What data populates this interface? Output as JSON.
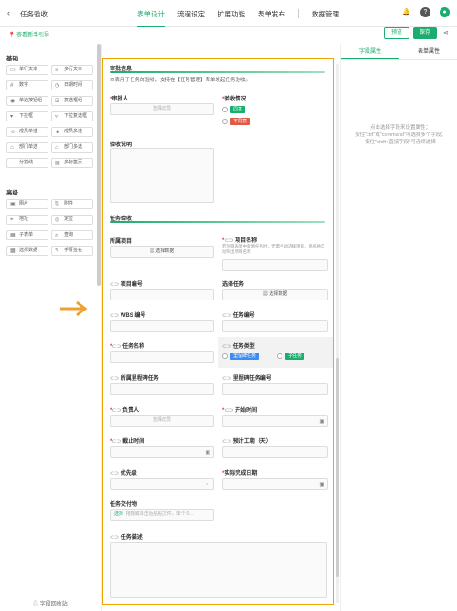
{
  "app": {
    "title": "任务验收",
    "back_icon": "chevron-left-icon"
  },
  "nav": {
    "tabs": [
      "表单设计",
      "流程设定",
      "扩展功能",
      "表单发布"
    ],
    "data_mgmt": "数据管理"
  },
  "subbar": {
    "guide": "查看新手引导",
    "preview": "预览",
    "save": "保存"
  },
  "palette": {
    "basic_title": "基础",
    "basic": [
      "单行文本",
      "多行文本",
      "数字",
      "日期时间",
      "单选按钮组",
      "复选框组",
      "下拉框",
      "下拉复选框",
      "成员单选",
      "成员多选",
      "部门单选",
      "部门多选",
      "分割线",
      "多标签页"
    ],
    "advanced_title": "高级",
    "advanced": [
      "图片",
      "附件",
      "地址",
      "定位",
      "子表单",
      "查询",
      "选择数据",
      "手写签名"
    ],
    "recycle": "字段回收站"
  },
  "form": {
    "sec1_title": "审批信息",
    "sec1_desc": "本表用于任务的验收，支持在【任务管理】表单发起任务验收。",
    "approver_label": "审批人",
    "approver_placeholder": "选择成员",
    "accept_label": "验收情况",
    "accept_options": [
      "同意",
      "不同意"
    ],
    "accept_note_label": "验收说明",
    "sec2_title": "任务验收",
    "project_label": "所属项目",
    "select_data": "选择数据",
    "project_name_label": "项目名称",
    "project_name_hint": "若项目表单中新增任务时，无需手动选择项目，系统将自动带出项目名称",
    "project_no_label": "项目编号",
    "choose_task_label": "选择任务",
    "wbs_label": "WBS 编号",
    "task_no_label": "任务编号",
    "task_name_label": "任务名称",
    "task_type_label": "任务类型",
    "task_type_options": [
      "里程碑任务",
      "子任务"
    ],
    "milestone_label": "所属里程碑任务",
    "milestone_no_label": "里程碑任务编号",
    "owner_label": "负责人",
    "owner_placeholder": "选择成员",
    "start_label": "开始时间",
    "deadline_label": "截止时间",
    "est_label": "预计工期（天）",
    "priority_label": "优先级",
    "actual_label": "实际完成日期",
    "deliverable_label": "任务交付物",
    "upload_btn": "选择",
    "upload_hint": "拖拽或单击后粘贴文件，单个(0...",
    "task_desc_label": "任务描述"
  },
  "right": {
    "tabs": [
      "字段属性",
      "表单属性"
    ],
    "hint_lines": [
      "点击选择字段来设置属性；",
      "按住\"ctrl\"或\"command\"可选择多个字段；",
      "按住\"shift+直接字段\"可连续选择"
    ]
  },
  "colors": {
    "brand": "#1aad6d",
    "canvas_border": "#f0a500",
    "agree": "#1aad6d",
    "disagree": "#e05a47",
    "milestone": "#3d8cf0",
    "subtask": "#1aad6d"
  }
}
